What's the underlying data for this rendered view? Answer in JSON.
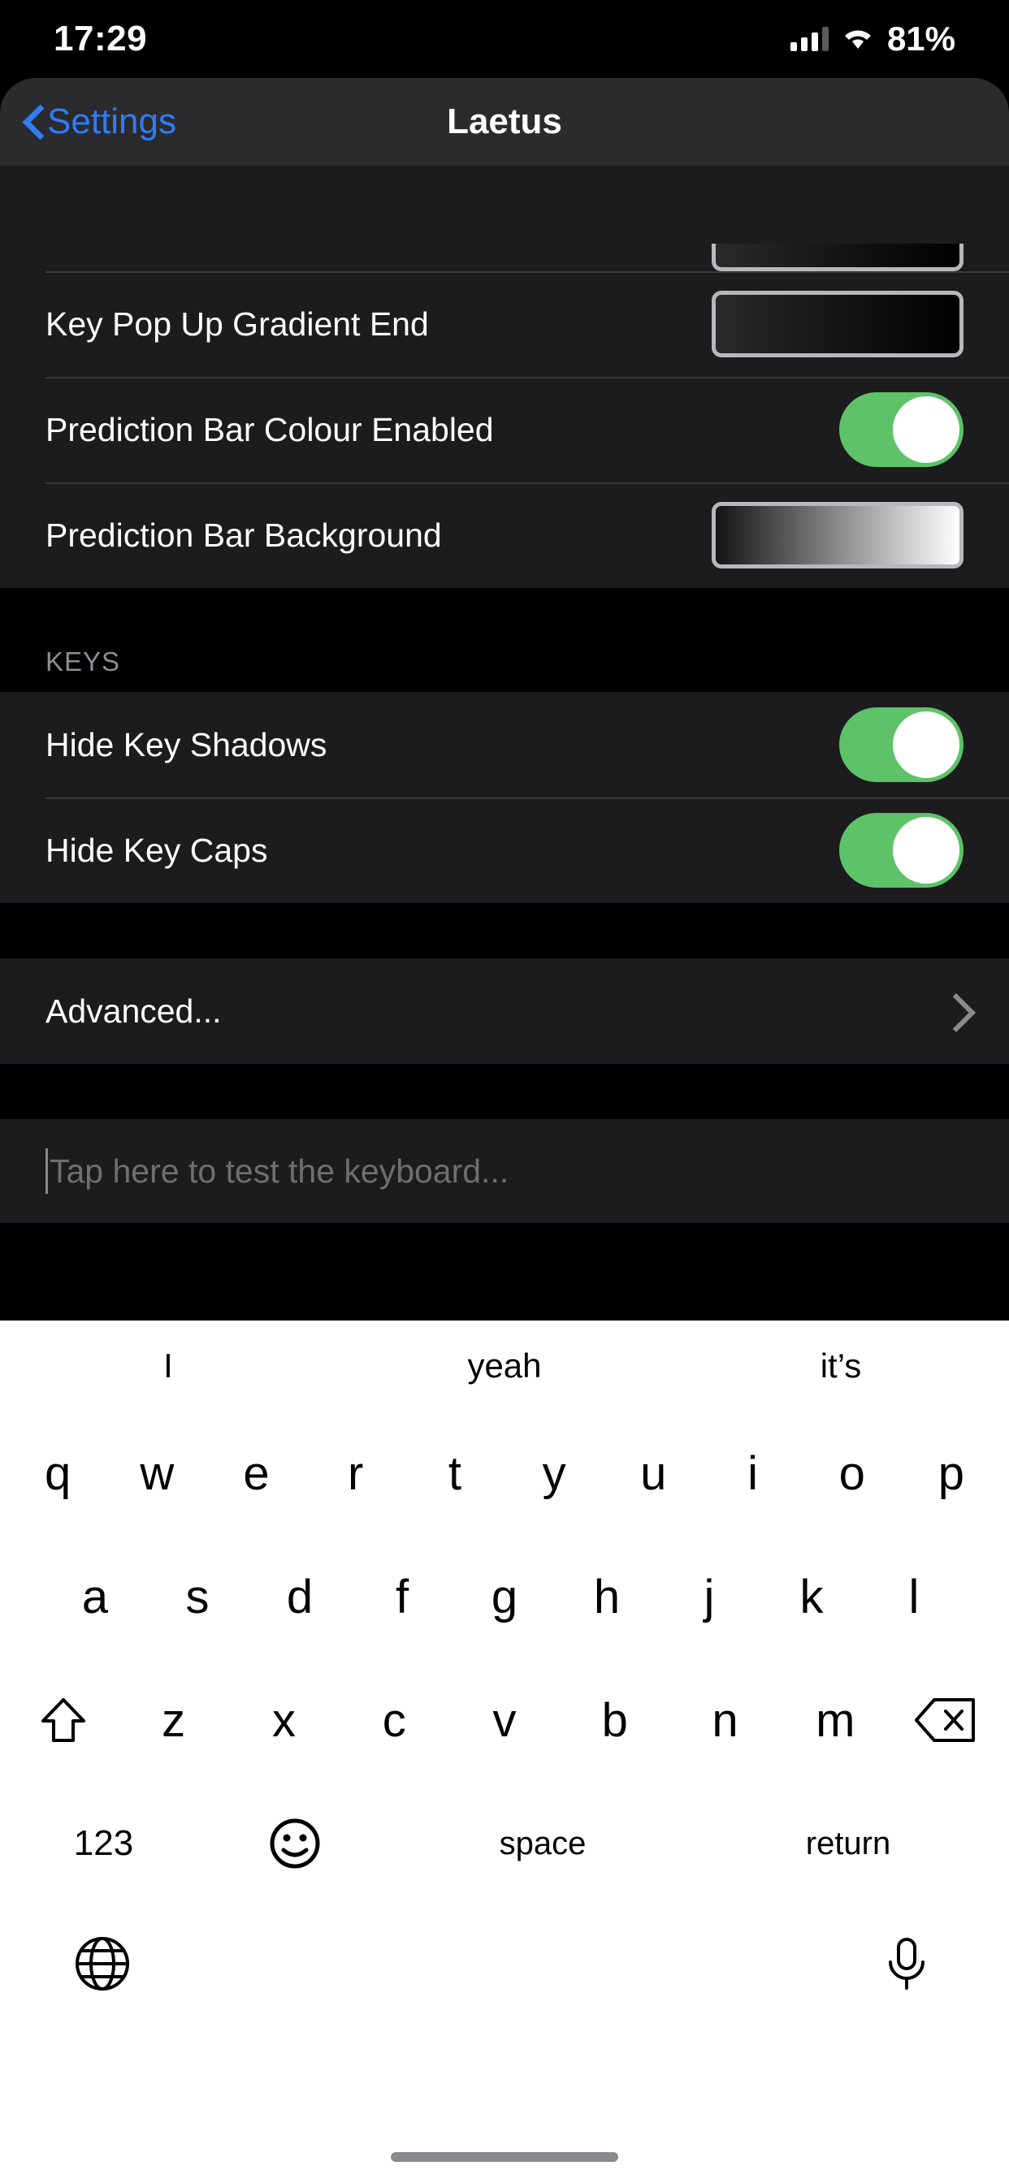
{
  "status_bar": {
    "time": "17:29",
    "battery_percent": "81%",
    "signal_icon": "cellular-bars-icon",
    "wifi_icon": "wifi-icon"
  },
  "nav_bar": {
    "back_label": "Settings",
    "back_icon": "chevron-left-icon",
    "title": "Laetus"
  },
  "settings": {
    "sections": [
      {
        "header": "",
        "rows": [
          {
            "label": "",
            "type": "color-partial",
            "swatch_start": "#2a2a2a",
            "swatch_end": "#000000"
          },
          {
            "label": "Key Pop Up Gradient End",
            "type": "color",
            "swatch_start": "#2a2a2a",
            "swatch_end": "#000000"
          },
          {
            "label": "Prediction Bar Colour Enabled",
            "type": "toggle",
            "value": "on"
          },
          {
            "label": "Prediction Bar Background",
            "type": "color",
            "swatch_start": "#141414",
            "swatch_end": "#ffffff"
          }
        ]
      },
      {
        "header": "KEYS",
        "rows": [
          {
            "label": "Hide Key Shadows",
            "type": "toggle",
            "value": "on"
          },
          {
            "label": "Hide Key Caps",
            "type": "toggle",
            "value": "on"
          }
        ]
      },
      {
        "header": "",
        "rows": [
          {
            "label": "Advanced...",
            "type": "disclosure",
            "accessory_icon": "chevron-right-icon"
          }
        ]
      },
      {
        "header": "",
        "rows": [
          {
            "label": "",
            "type": "textfield",
            "value": "",
            "placeholder": "Tap here to test the keyboard..."
          }
        ]
      }
    ]
  },
  "keyboard": {
    "predictions": [
      "I",
      "yeah",
      "it’s"
    ],
    "row1": [
      "q",
      "w",
      "e",
      "r",
      "t",
      "y",
      "u",
      "i",
      "o",
      "p"
    ],
    "row2": [
      "a",
      "s",
      "d",
      "f",
      "g",
      "h",
      "j",
      "k",
      "l"
    ],
    "row3": [
      "z",
      "x",
      "c",
      "v",
      "b",
      "n",
      "m"
    ],
    "shift_icon": "shift-icon",
    "backspace_icon": "backspace-icon",
    "numbers_label": "123",
    "emoji_icon": "emoji-smiley-icon",
    "space_label": "space",
    "return_label": "return",
    "globe_icon": "globe-icon",
    "mic_icon": "microphone-icon"
  },
  "colors": {
    "accent_blue": "#2f7cf6",
    "toggle_on_green": "#5ec269",
    "row_background": "#1c1c1e",
    "page_background": "#000000",
    "separator": "#3a3a3c",
    "secondary_text": "#8e8e93",
    "keyboard_background": "#ffffff"
  }
}
